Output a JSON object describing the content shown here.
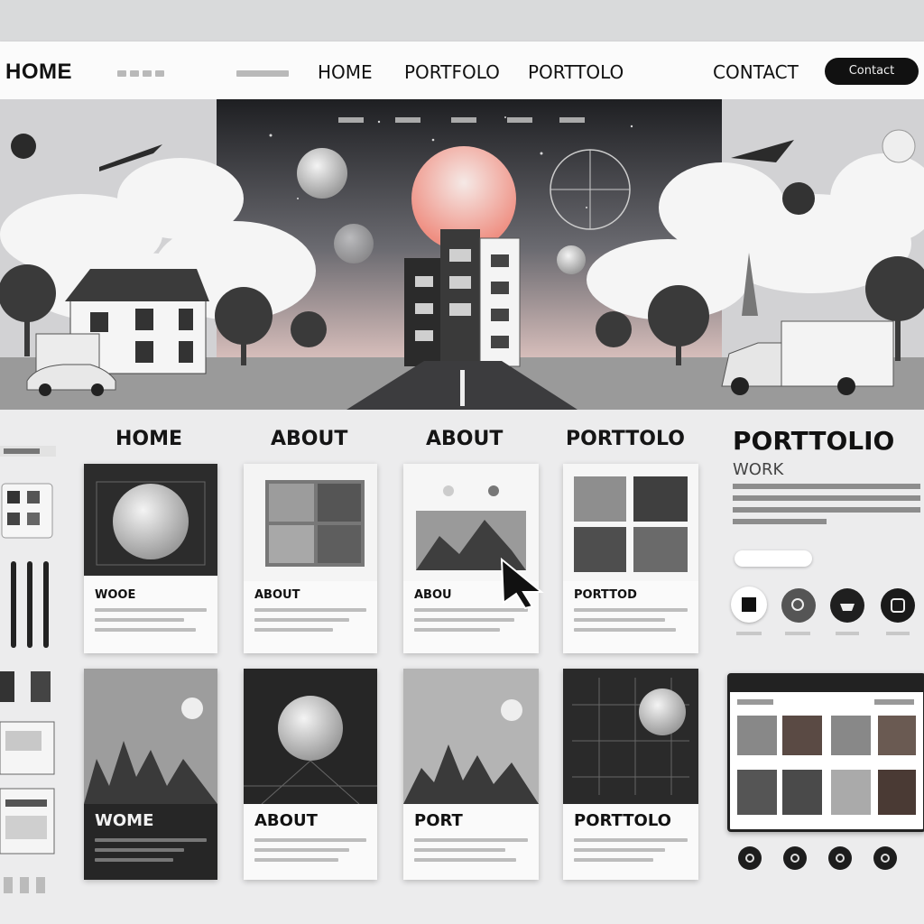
{
  "header": {
    "brand": "HOME",
    "nav": [
      "HOME",
      "PORTFOLO",
      "PORTTOLO",
      "CONTACT"
    ],
    "cta": "Contact"
  },
  "section": {
    "titles": [
      "HOME",
      "ABOUT",
      "ABOUT",
      "PORTTOLO"
    ],
    "cards_top": [
      "WOOE",
      "ABOUT",
      "ABOU",
      "PORTTOD"
    ],
    "cards_bottom": [
      "WOME",
      "ABOUT",
      "PORT",
      "PORTTOLO"
    ]
  },
  "portfolio_panel": {
    "title": "PORTTOLIO",
    "subtitle": "WORK"
  },
  "icons": [
    "home-icon",
    "search-icon",
    "gear-icon",
    "close-icon"
  ],
  "colors": {
    "accent": "#111111",
    "sun": "#f2a79a",
    "background": "#ececed"
  }
}
